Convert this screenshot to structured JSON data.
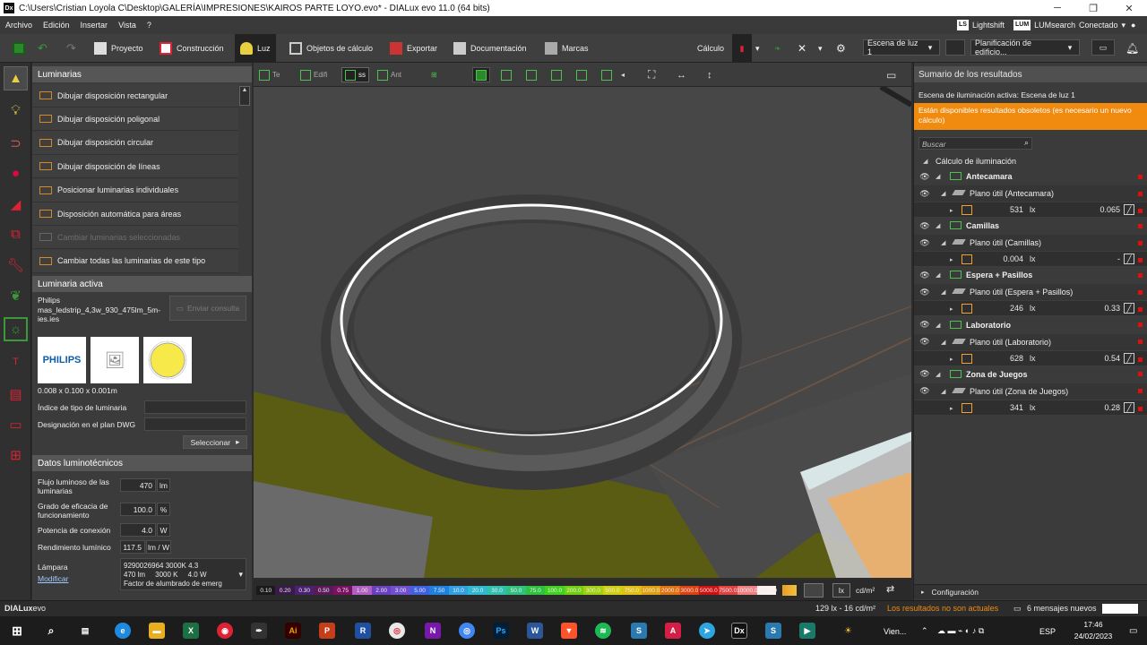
{
  "window": {
    "title": "C:\\Users\\Cristian Loyola C\\Desktop\\GALERÍA\\IMPRESIONES\\KAIROS PARTE LOYO.evo* - DIALux evo 11.0  (64 bits)",
    "app_icon": "Dx"
  },
  "menu": {
    "items": [
      "Archivo",
      "Edición",
      "Insertar",
      "Vista",
      "?"
    ],
    "lightshift": "Lightshift",
    "lightshift_badge": "LS",
    "lumsearch": "LUMsearch",
    "lumsearch_badge": "LUM",
    "connected": "Conectado"
  },
  "toolbar": {
    "proyecto": "Proyecto",
    "construccion": "Construcción",
    "luz": "Luz",
    "objetos": "Objetos de cálculo",
    "exportar": "Exportar",
    "documentacion": "Documentación",
    "marcas": "Marcas",
    "calculo": "Cálculo",
    "scene": "Escena de luz 1",
    "planning": "Planificación de edificio..."
  },
  "left_panel": {
    "header": "Luminarias",
    "items": [
      {
        "label": "Dibujar disposición rectangular",
        "disabled": false
      },
      {
        "label": "Dibujar disposición poligonal",
        "disabled": false
      },
      {
        "label": "Dibujar disposición circular",
        "disabled": false
      },
      {
        "label": "Dibujar disposición de líneas",
        "disabled": false
      },
      {
        "label": "Posicionar luminarias individuales",
        "disabled": false
      },
      {
        "label": "Disposición automática para áreas",
        "disabled": false
      },
      {
        "label": "Cambiar luminarias seleccionadas",
        "disabled": true
      },
      {
        "label": "Cambiar todas las luminarias de este tipo",
        "disabled": false
      }
    ],
    "active_header": "Luminaria activa",
    "manufacturer": "Philips",
    "luminaire_file": "mas_ledstrip_4,3w_930_475lm_5m-ies.ies",
    "send_query": "Enviar consulta",
    "brand_logo": "PHILIPS",
    "dimensions": "0.008 x 0.100 x 0.001m",
    "type_index_label": "Índice de tipo de luminaria",
    "dwg_label": "Designación en el plan DWG",
    "select_button": "Seleccionar",
    "photometric_header": "Datos luminotécnicos",
    "flux_label": "Flujo luminoso de las luminarias",
    "flux_value": "470",
    "flux_unit": "lm",
    "efficiency_label": "Grado de eficacia de funcionamiento",
    "efficiency_value": "100.0",
    "efficiency_unit": "%",
    "power_label": "Potencia de conexión",
    "power_value": "4.0",
    "power_unit": "W",
    "yield_label": "Rendimiento lumínico",
    "yield_value": "117.5",
    "yield_unit": "lm / W",
    "lamp_label": "Lámpara",
    "modify_link": "Modificar",
    "lamp_line1": "9290026964 3000K 4.3",
    "lamp_line2": "470 lm     3000 K     4.0 W",
    "lamp_line3": "Factor de alumbrado de emerg"
  },
  "view_toolbar": {
    "tabs": [
      "Te",
      "Edifi",
      "ss",
      "Ant"
    ]
  },
  "scale": {
    "values": [
      "0.10",
      "0.20",
      "0.30",
      "0.50",
      "0.75",
      "1.00",
      "2.00",
      "3.00",
      "5.00",
      "7.50",
      "10.0",
      "20.0",
      "30.0",
      "50.0",
      "75.0",
      "100.0",
      "200.0",
      "300.0",
      "500.0",
      "750.0",
      "1000.0",
      "2000.0",
      "3000.0",
      "5000.0",
      "7500.0",
      "10000.0",
      "15000.0"
    ],
    "colors": [
      "#1a1a1a",
      "#3a1a4a",
      "#4a2070",
      "#5a1a5a",
      "#7a1060",
      "#b060c0",
      "#6a40c0",
      "#7050d0",
      "#4060e0",
      "#2080e0",
      "#30a0e0",
      "#30b8d0",
      "#30c0b0",
      "#30c080",
      "#30c040",
      "#40d020",
      "#70d010",
      "#a0d010",
      "#d0d010",
      "#e0c010",
      "#e0a010",
      "#e07010",
      "#e04010",
      "#d01010",
      "#e04040",
      "#f08080",
      "#fff0f0"
    ],
    "unit_lx": "lx",
    "unit_cd": "cd/m²"
  },
  "right_panel": {
    "header": "Sumario de los resultados",
    "active_scene": "Escena de iluminación activa: Escena de luz 1",
    "warning": "Están disponibles resultados obsoletos (es necesario un nuevo cálculo)",
    "search_placeholder": "Buscar",
    "calc_header": "Cálculo de iluminación",
    "rooms": [
      {
        "name": "Antecamara",
        "plane": "Plano útil (Antecamara)",
        "value": "531",
        "unit": "lx",
        "ratio": "0.065"
      },
      {
        "name": "Camillas",
        "plane": "Plano útil (Camillas)",
        "value": "0.004",
        "unit": "lx",
        "ratio": "-"
      },
      {
        "name": "Espera + Pasillos",
        "plane": "Plano útil (Espera + Pasillos)",
        "value": "246",
        "unit": "lx",
        "ratio": "0.33"
      },
      {
        "name": "Laboratorio",
        "plane": "Plano útil (Laboratorio)",
        "value": "628",
        "unit": "lx",
        "ratio": "0.54"
      },
      {
        "name": "Zona de Juegos",
        "plane": "Plano útil (Zona de Juegos)",
        "value": "341",
        "unit": "lx",
        "ratio": "0.28"
      }
    ],
    "config": "Configuración"
  },
  "status": {
    "logo_a": "DIALux",
    "logo_b": "evo",
    "readout": "129 lx - 16 cd/m²",
    "stale": "Los resultados no son actuales",
    "messages": "6 mensajes nuevos"
  },
  "taskbar": {
    "weather": "Vien...",
    "lang": "ESP",
    "time": "17:46",
    "date": "24/02/2023"
  }
}
